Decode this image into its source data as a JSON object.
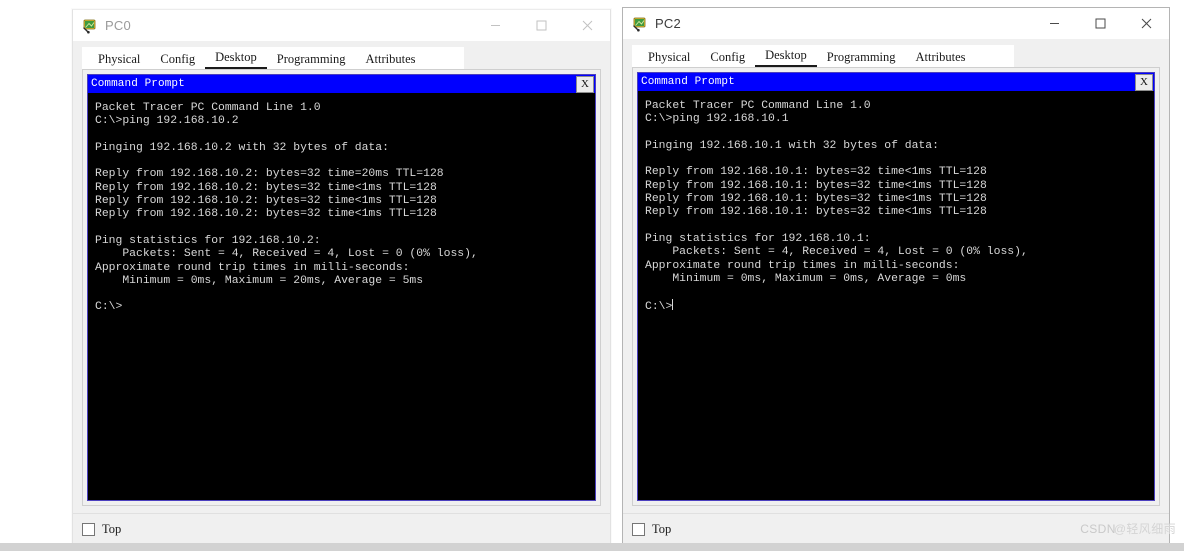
{
  "windows": [
    {
      "id": "pc0",
      "title": "PC0",
      "icon": "packet-tracer-pc-icon",
      "active": false,
      "controls": {
        "minimize": "minimize-icon",
        "maximize": "maximize-icon",
        "close": "close-icon"
      },
      "tabs": [
        {
          "label": "Physical",
          "selected": false
        },
        {
          "label": "Config",
          "selected": false
        },
        {
          "label": "Desktop",
          "selected": true
        },
        {
          "label": "Programming",
          "selected": false
        },
        {
          "label": "Attributes",
          "selected": false
        }
      ],
      "cmd": {
        "title": "Command Prompt",
        "close_label": "X",
        "lines": [
          "Packet Tracer PC Command Line 1.0",
          "C:\\>ping 192.168.10.2",
          "",
          "Pinging 192.168.10.2 with 32 bytes of data:",
          "",
          "Reply from 192.168.10.2: bytes=32 time=20ms TTL=128",
          "Reply from 192.168.10.2: bytes=32 time<1ms TTL=128",
          "Reply from 192.168.10.2: bytes=32 time<1ms TTL=128",
          "Reply from 192.168.10.2: bytes=32 time<1ms TTL=128",
          "",
          "Ping statistics for 192.168.10.2:",
          "    Packets: Sent = 4, Received = 4, Lost = 0 (0% loss),",
          "Approximate round trip times in milli-seconds:",
          "    Minimum = 0ms, Maximum = 20ms, Average = 5ms",
          "",
          "C:\\>"
        ],
        "cursor": false
      },
      "footer": {
        "checkbox_label": "Top",
        "checked": false
      }
    },
    {
      "id": "pc2",
      "title": "PC2",
      "icon": "packet-tracer-pc-icon",
      "active": true,
      "controls": {
        "minimize": "minimize-icon",
        "maximize": "maximize-icon",
        "close": "close-icon"
      },
      "tabs": [
        {
          "label": "Physical",
          "selected": false
        },
        {
          "label": "Config",
          "selected": false
        },
        {
          "label": "Desktop",
          "selected": true
        },
        {
          "label": "Programming",
          "selected": false
        },
        {
          "label": "Attributes",
          "selected": false
        }
      ],
      "cmd": {
        "title": "Command Prompt",
        "close_label": "X",
        "lines": [
          "Packet Tracer PC Command Line 1.0",
          "C:\\>ping 192.168.10.1",
          "",
          "Pinging 192.168.10.1 with 32 bytes of data:",
          "",
          "Reply from 192.168.10.1: bytes=32 time<1ms TTL=128",
          "Reply from 192.168.10.1: bytes=32 time<1ms TTL=128",
          "Reply from 192.168.10.1: bytes=32 time<1ms TTL=128",
          "Reply from 192.168.10.1: bytes=32 time<1ms TTL=128",
          "",
          "Ping statistics for 192.168.10.1:",
          "    Packets: Sent = 4, Received = 4, Lost = 0 (0% loss),",
          "Approximate round trip times in milli-seconds:",
          "    Minimum = 0ms, Maximum = 0ms, Average = 0ms",
          "",
          "C:\\>"
        ],
        "cursor": true
      },
      "footer": {
        "checkbox_label": "Top",
        "checked": false
      }
    }
  ],
  "watermark": {
    "brand": "CSDN",
    "user": "@轻风细雨"
  },
  "colors": {
    "cmd_titlebar": "#0000ff",
    "cmd_background": "#000000",
    "cmd_text": "#d8d8d8",
    "window_chrome": "#f0f0f0",
    "tab_underline": "#1b1b1b"
  }
}
